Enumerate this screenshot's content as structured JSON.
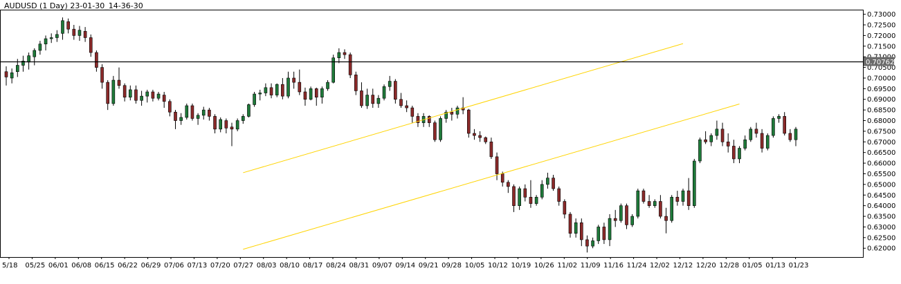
{
  "chart_data": {
    "type": "candlestick",
    "title": "AUDUSD (1 Day) 23-01-30_14-36-30",
    "colors": {
      "up": "#1f7a3a",
      "down": "#8b2a2a",
      "wick": "#000000",
      "channel": "#ffd400",
      "price_line": "#000000",
      "tag_bg": "#6b6b6b",
      "frame": "#000000"
    },
    "ylim": [
      0.6165,
      0.7315
    ],
    "y_ticks": [
      "0.73000",
      "0.72500",
      "0.72000",
      "0.71500",
      "0.71000",
      "0.70500",
      "0.70000",
      "0.69500",
      "0.69000",
      "0.68500",
      "0.68000",
      "0.67500",
      "0.67000",
      "0.66500",
      "0.66000",
      "0.65500",
      "0.65000",
      "0.64500",
      "0.64000",
      "0.63500",
      "0.63000",
      "0.62500",
      "0.62000"
    ],
    "y_tick_values": [
      0.73,
      0.725,
      0.72,
      0.715,
      0.71,
      0.705,
      0.7,
      0.695,
      0.69,
      0.685,
      0.68,
      0.675,
      0.67,
      0.665,
      0.66,
      0.655,
      0.65,
      0.645,
      0.64,
      0.635,
      0.63,
      0.625,
      0.62
    ],
    "x_ticks": [
      "5/18",
      "05/25",
      "06/01",
      "06/08",
      "06/15",
      "06/22",
      "06/29",
      "07/06",
      "07/13",
      "07/20",
      "07/27",
      "08/03",
      "08/10",
      "08/17",
      "08/24",
      "08/31",
      "09/07",
      "09/14",
      "09/21",
      "09/28",
      "10/05",
      "10/12",
      "10/19",
      "10/26",
      "11/02",
      "11/09",
      "11/16",
      "11/24",
      "12/02",
      "12/12",
      "12/20",
      "12/28",
      "01/05",
      "01/13",
      "01/23"
    ],
    "current_price": "0.70762",
    "current_price_value": 0.70762,
    "channel": {
      "upper": [
        [
          42,
          0.6555
        ],
        [
          120,
          0.7162
        ]
      ],
      "lower": [
        [
          42,
          0.6195
        ],
        [
          130,
          0.6878
        ]
      ]
    },
    "candles": [
      [
        0.703,
        0.7055,
        0.6965,
        0.7005
      ],
      [
        0.7,
        0.7045,
        0.6975,
        0.7025
      ],
      [
        0.703,
        0.709,
        0.7005,
        0.706
      ],
      [
        0.706,
        0.7105,
        0.703,
        0.708
      ],
      [
        0.7075,
        0.712,
        0.704,
        0.7105
      ],
      [
        0.71,
        0.714,
        0.706,
        0.713
      ],
      [
        0.713,
        0.7175,
        0.711,
        0.716
      ],
      [
        0.716,
        0.72,
        0.713,
        0.7185
      ],
      [
        0.7185,
        0.721,
        0.7165,
        0.719
      ],
      [
        0.719,
        0.7225,
        0.717,
        0.7205
      ],
      [
        0.721,
        0.7285,
        0.718,
        0.727
      ],
      [
        0.7265,
        0.728,
        0.721,
        0.723
      ],
      [
        0.723,
        0.725,
        0.718,
        0.72
      ],
      [
        0.72,
        0.7245,
        0.7175,
        0.7225
      ],
      [
        0.722,
        0.724,
        0.717,
        0.719
      ],
      [
        0.719,
        0.7205,
        0.71,
        0.712
      ],
      [
        0.712,
        0.713,
        0.703,
        0.705
      ],
      [
        0.705,
        0.7065,
        0.695,
        0.698
      ],
      [
        0.698,
        0.699,
        0.685,
        0.688
      ],
      [
        0.688,
        0.701,
        0.687,
        0.699
      ],
      [
        0.699,
        0.705,
        0.695,
        0.6965
      ],
      [
        0.6965,
        0.6975,
        0.689,
        0.691
      ],
      [
        0.691,
        0.6965,
        0.6895,
        0.6945
      ],
      [
        0.6945,
        0.6965,
        0.688,
        0.6895
      ],
      [
        0.6895,
        0.694,
        0.687,
        0.6915
      ],
      [
        0.6915,
        0.6945,
        0.6885,
        0.6935
      ],
      [
        0.6935,
        0.6945,
        0.689,
        0.6905
      ],
      [
        0.6905,
        0.6935,
        0.6895,
        0.6925
      ],
      [
        0.692,
        0.6935,
        0.686,
        0.689
      ],
      [
        0.689,
        0.69,
        0.682,
        0.684
      ],
      [
        0.684,
        0.685,
        0.676,
        0.68
      ],
      [
        0.68,
        0.6835,
        0.678,
        0.6815
      ],
      [
        0.6815,
        0.688,
        0.6805,
        0.687
      ],
      [
        0.687,
        0.688,
        0.68,
        0.681
      ],
      [
        0.681,
        0.6835,
        0.678,
        0.6825
      ],
      [
        0.6825,
        0.6865,
        0.6805,
        0.685
      ],
      [
        0.685,
        0.686,
        0.68,
        0.682
      ],
      [
        0.682,
        0.683,
        0.674,
        0.676
      ],
      [
        0.676,
        0.6815,
        0.6745,
        0.6805
      ],
      [
        0.68,
        0.681,
        0.674,
        0.6765
      ],
      [
        0.677,
        0.679,
        0.668,
        0.676
      ],
      [
        0.676,
        0.681,
        0.675,
        0.68
      ],
      [
        0.68,
        0.683,
        0.6785,
        0.682
      ],
      [
        0.682,
        0.688,
        0.6815,
        0.6875
      ],
      [
        0.6875,
        0.6935,
        0.6865,
        0.6925
      ],
      [
        0.6925,
        0.6945,
        0.6895,
        0.693
      ],
      [
        0.693,
        0.6975,
        0.6915,
        0.6955
      ],
      [
        0.6955,
        0.6975,
        0.6905,
        0.692
      ],
      [
        0.692,
        0.6975,
        0.691,
        0.697
      ],
      [
        0.697,
        0.7,
        0.69,
        0.6915
      ],
      [
        0.6915,
        0.703,
        0.6905,
        0.7
      ],
      [
        0.7,
        0.703,
        0.695,
        0.698
      ],
      [
        0.698,
        0.704,
        0.692,
        0.6935
      ],
      [
        0.6935,
        0.6955,
        0.687,
        0.69
      ],
      [
        0.69,
        0.696,
        0.6895,
        0.695
      ],
      [
        0.695,
        0.6955,
        0.687,
        0.691
      ],
      [
        0.691,
        0.696,
        0.688,
        0.695
      ],
      [
        0.695,
        0.699,
        0.694,
        0.698
      ],
      [
        0.698,
        0.711,
        0.6975,
        0.7095
      ],
      [
        0.7095,
        0.714,
        0.707,
        0.712
      ],
      [
        0.712,
        0.7135,
        0.709,
        0.711
      ],
      [
        0.711,
        0.712,
        0.7,
        0.7015
      ],
      [
        0.7015,
        0.703,
        0.692,
        0.694
      ],
      [
        0.694,
        0.698,
        0.686,
        0.687
      ],
      [
        0.687,
        0.695,
        0.6855,
        0.692
      ],
      [
        0.692,
        0.695,
        0.686,
        0.688
      ],
      [
        0.688,
        0.692,
        0.686,
        0.6905
      ],
      [
        0.6905,
        0.697,
        0.6895,
        0.696
      ],
      [
        0.696,
        0.701,
        0.694,
        0.6985
      ],
      [
        0.6985,
        0.6995,
        0.688,
        0.69
      ],
      [
        0.69,
        0.693,
        0.686,
        0.687
      ],
      [
        0.687,
        0.6895,
        0.684,
        0.686
      ],
      [
        0.686,
        0.687,
        0.679,
        0.682
      ],
      [
        0.682,
        0.6835,
        0.677,
        0.679
      ],
      [
        0.679,
        0.6835,
        0.677,
        0.682
      ],
      [
        0.682,
        0.6825,
        0.677,
        0.679
      ],
      [
        0.679,
        0.68,
        0.67,
        0.671
      ],
      [
        0.671,
        0.682,
        0.67,
        0.681
      ],
      [
        0.681,
        0.685,
        0.679,
        0.684
      ],
      [
        0.684,
        0.686,
        0.68,
        0.683
      ],
      [
        0.683,
        0.687,
        0.681,
        0.686
      ],
      [
        0.686,
        0.691,
        0.683,
        0.685
      ],
      [
        0.685,
        0.6855,
        0.672,
        0.674
      ],
      [
        0.674,
        0.676,
        0.671,
        0.673
      ],
      [
        0.673,
        0.675,
        0.67,
        0.672
      ],
      [
        0.672,
        0.6725,
        0.669,
        0.67
      ],
      [
        0.67,
        0.672,
        0.662,
        0.663
      ],
      [
        0.663,
        0.665,
        0.652,
        0.655
      ],
      [
        0.655,
        0.656,
        0.649,
        0.651
      ],
      [
        0.651,
        0.652,
        0.646,
        0.649
      ],
      [
        0.649,
        0.65,
        0.637,
        0.64
      ],
      [
        0.64,
        0.649,
        0.638,
        0.648
      ],
      [
        0.648,
        0.65,
        0.642,
        0.644
      ],
      [
        0.644,
        0.652,
        0.639,
        0.641
      ],
      [
        0.641,
        0.645,
        0.64,
        0.644
      ],
      [
        0.644,
        0.652,
        0.643,
        0.65
      ],
      [
        0.65,
        0.6555,
        0.648,
        0.653
      ],
      [
        0.653,
        0.6545,
        0.647,
        0.648
      ],
      [
        0.648,
        0.649,
        0.64,
        0.642
      ],
      [
        0.642,
        0.643,
        0.634,
        0.636
      ],
      [
        0.636,
        0.637,
        0.625,
        0.627
      ],
      [
        0.627,
        0.634,
        0.625,
        0.632
      ],
      [
        0.632,
        0.634,
        0.621,
        0.624
      ],
      [
        0.624,
        0.626,
        0.618,
        0.621
      ],
      [
        0.621,
        0.625,
        0.62,
        0.6235
      ],
      [
        0.6235,
        0.631,
        0.622,
        0.63
      ],
      [
        0.63,
        0.632,
        0.622,
        0.624
      ],
      [
        0.624,
        0.636,
        0.621,
        0.634
      ],
      [
        0.634,
        0.638,
        0.63,
        0.633
      ],
      [
        0.633,
        0.641,
        0.632,
        0.64
      ],
      [
        0.64,
        0.641,
        0.629,
        0.631
      ],
      [
        0.631,
        0.636,
        0.63,
        0.635
      ],
      [
        0.635,
        0.648,
        0.634,
        0.647
      ],
      [
        0.647,
        0.648,
        0.641,
        0.642
      ],
      [
        0.642,
        0.645,
        0.639,
        0.64
      ],
      [
        0.64,
        0.643,
        0.639,
        0.642
      ],
      [
        0.642,
        0.645,
        0.634,
        0.635
      ],
      [
        0.635,
        0.639,
        0.627,
        0.633
      ],
      [
        0.633,
        0.645,
        0.632,
        0.644
      ],
      [
        0.644,
        0.647,
        0.64,
        0.642
      ],
      [
        0.642,
        0.648,
        0.64,
        0.647
      ],
      [
        0.647,
        0.653,
        0.638,
        0.64
      ],
      [
        0.64,
        0.662,
        0.639,
        0.661
      ],
      [
        0.661,
        0.672,
        0.66,
        0.671
      ],
      [
        0.671,
        0.675,
        0.669,
        0.67
      ],
      [
        0.67,
        0.674,
        0.668,
        0.673
      ],
      [
        0.673,
        0.68,
        0.671,
        0.676
      ],
      [
        0.676,
        0.679,
        0.668,
        0.67
      ],
      [
        0.67,
        0.674,
        0.665,
        0.668
      ],
      [
        0.668,
        0.671,
        0.66,
        0.662
      ],
      [
        0.662,
        0.668,
        0.66,
        0.667
      ],
      [
        0.667,
        0.673,
        0.666,
        0.671
      ],
      [
        0.671,
        0.677,
        0.67,
        0.676
      ],
      [
        0.676,
        0.679,
        0.672,
        0.674
      ],
      [
        0.674,
        0.676,
        0.665,
        0.667
      ],
      [
        0.667,
        0.674,
        0.666,
        0.673
      ],
      [
        0.673,
        0.682,
        0.672,
        0.681
      ],
      [
        0.681,
        0.683,
        0.679,
        0.682
      ],
      [
        0.682,
        0.684,
        0.673,
        0.674
      ],
      [
        0.674,
        0.676,
        0.67,
        0.671
      ],
      [
        0.671,
        0.677,
        0.668,
        0.676
      ]
    ]
  }
}
